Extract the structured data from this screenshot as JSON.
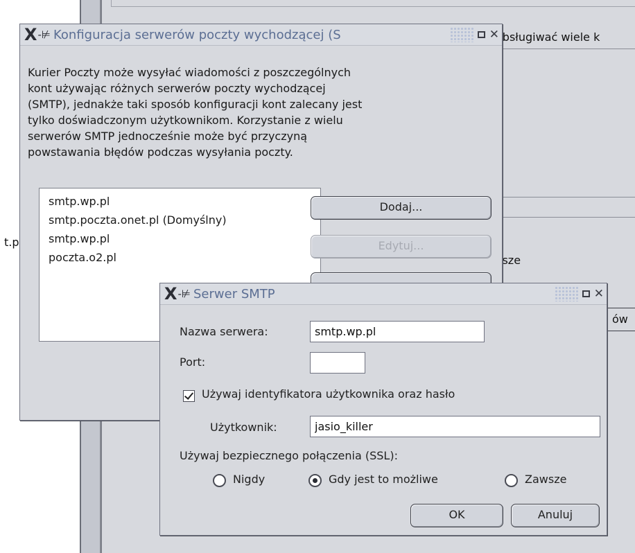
{
  "background": {
    "left_text": "t.p",
    "right_top_text": "obsługiwać wiele k",
    "right_mid_text": "ysze",
    "right_btn_text": "ów"
  },
  "outgoing_dialog": {
    "title": "Konfiguracja serwerów poczty wychodzącej (S",
    "description_lines": [
      "Kurier Poczty może wysyłać wiadomości z poszczególnych",
      "kont używając różnych serwerów poczty wychodzącej",
      "(SMTP), jednakże taki sposób konfiguracji kont zalecany jest",
      "tylko doświadczonym użytkownikom. Korzystanie z wielu",
      "serwerów SMTP jednocześnie może być przyczyną",
      "powstawania błędów podczas wysyłania poczty."
    ],
    "servers": [
      "smtp.wp.pl",
      "smtp.poczta.onet.pl (Domyślny)",
      "smtp.wp.pl",
      "poczta.o2.pl"
    ],
    "add_label": "Dodaj...",
    "edit_label": "Edytuj..."
  },
  "smtp_dialog": {
    "title": "Serwer SMTP",
    "server_name_label": "Nazwa serwera:",
    "server_name_value": "smtp.wp.pl",
    "port_label": "Port:",
    "port_value": "",
    "auth_checkbox_label": "Używaj identyfikatora użytkownika oraz hasło",
    "auth_checked": true,
    "user_label": "Użytkownik:",
    "user_value": "jasio_killer",
    "ssl_label": "Używaj bezpiecznego połączenia (SSL):",
    "ssl_options": [
      "Nigdy",
      "Gdy jest to możliwe",
      "Zawsze"
    ],
    "ssl_selected": "Gdy jest to możliwe",
    "ok_label": "OK",
    "cancel_label": "Anuluj"
  },
  "colors": {
    "window_bg": "#d7d9de",
    "title_text": "#5b6e93",
    "disabled_text": "#a7aab2"
  }
}
